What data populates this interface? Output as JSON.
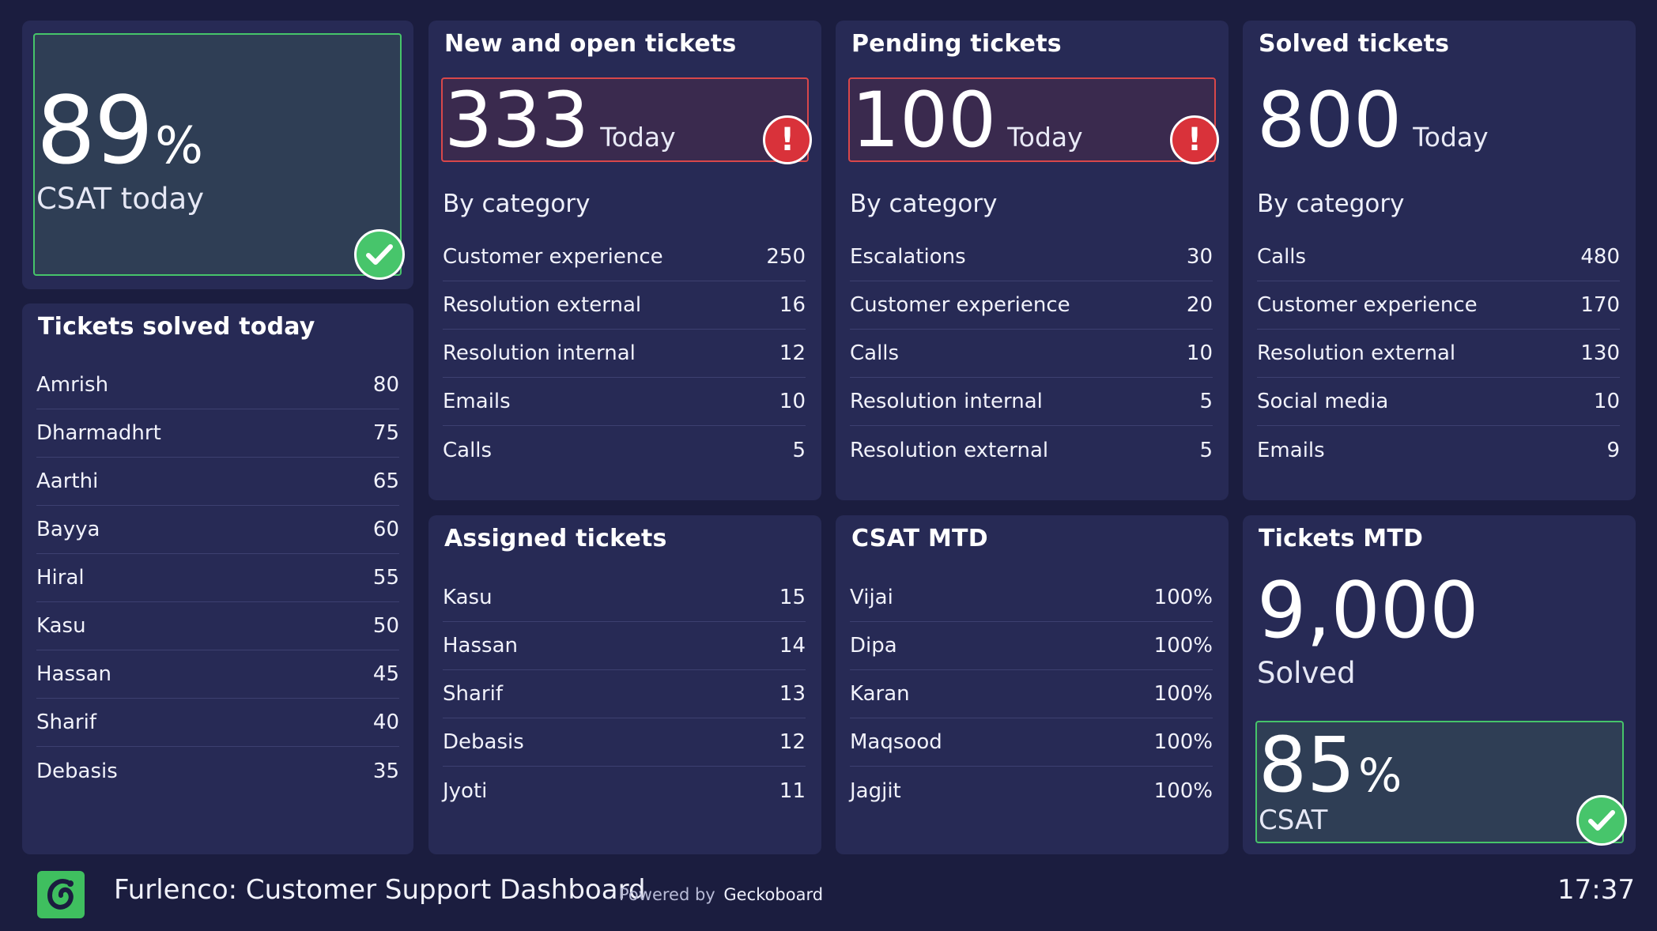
{
  "csat_today": {
    "value": "89",
    "unit": "%",
    "label": "CSAT today"
  },
  "new_open": {
    "title": "New and open tickets",
    "value": "333",
    "suffix": "Today",
    "by_category_label": "By category",
    "items": [
      {
        "label": "Customer experience",
        "value": "250"
      },
      {
        "label": "Resolution external",
        "value": "16"
      },
      {
        "label": "Resolution internal",
        "value": "12"
      },
      {
        "label": "Emails",
        "value": "10"
      },
      {
        "label": "Calls",
        "value": "5"
      }
    ]
  },
  "pending": {
    "title": "Pending tickets",
    "value": "100",
    "suffix": "Today",
    "by_category_label": "By category",
    "items": [
      {
        "label": "Escalations",
        "value": "30"
      },
      {
        "label": "Customer experience",
        "value": "20"
      },
      {
        "label": "Calls",
        "value": "10"
      },
      {
        "label": "Resolution internal",
        "value": "5"
      },
      {
        "label": "Resolution external",
        "value": "5"
      }
    ]
  },
  "solved": {
    "title": "Solved tickets",
    "value": "800",
    "suffix": "Today",
    "by_category_label": "By category",
    "items": [
      {
        "label": "Calls",
        "value": "480"
      },
      {
        "label": "Customer experience",
        "value": "170"
      },
      {
        "label": "Resolution external",
        "value": "130"
      },
      {
        "label": "Social media",
        "value": "10"
      },
      {
        "label": "Emails",
        "value": "9"
      }
    ]
  },
  "solved_today": {
    "title": "Tickets solved today",
    "items": [
      {
        "label": "Amrish",
        "value": "80"
      },
      {
        "label": "Dharmadhrt",
        "value": "75"
      },
      {
        "label": "Aarthi",
        "value": "65"
      },
      {
        "label": "Bayya",
        "value": "60"
      },
      {
        "label": "Hiral",
        "value": "55"
      },
      {
        "label": "Kasu",
        "value": "50"
      },
      {
        "label": "Hassan",
        "value": "45"
      },
      {
        "label": "Sharif",
        "value": "40"
      },
      {
        "label": "Debasis",
        "value": "35"
      }
    ]
  },
  "assigned": {
    "title": "Assigned tickets",
    "items": [
      {
        "label": "Kasu",
        "value": "15"
      },
      {
        "label": "Hassan",
        "value": "14"
      },
      {
        "label": "Sharif",
        "value": "13"
      },
      {
        "label": "Debasis",
        "value": "12"
      },
      {
        "label": "Jyoti",
        "value": "11"
      }
    ]
  },
  "csat_mtd": {
    "title": "CSAT MTD",
    "items": [
      {
        "label": "Vijai",
        "value": "100%"
      },
      {
        "label": "Dipa",
        "value": "100%"
      },
      {
        "label": "Karan",
        "value": "100%"
      },
      {
        "label": "Maqsood",
        "value": "100%"
      },
      {
        "label": "Jagjit",
        "value": "100%"
      }
    ]
  },
  "tickets_mtd": {
    "title": "Tickets MTD",
    "value": "9,000",
    "label": "Solved",
    "csat_value": "85",
    "csat_unit": "%",
    "csat_label": "CSAT"
  },
  "footer": {
    "dashboard_title": "Furlenco: Customer Support Dashboard",
    "powered_by": "Powered by",
    "brand": "Geckoboard",
    "time": "17:37"
  },
  "colors": {
    "background": "#1b1d3f",
    "panel": "#272a55",
    "alert": "#d9474a",
    "success": "#46c46a",
    "logo": "#3fbf5f"
  },
  "icons": [
    "check-icon",
    "alert-icon",
    "geckoboard-logo"
  ]
}
